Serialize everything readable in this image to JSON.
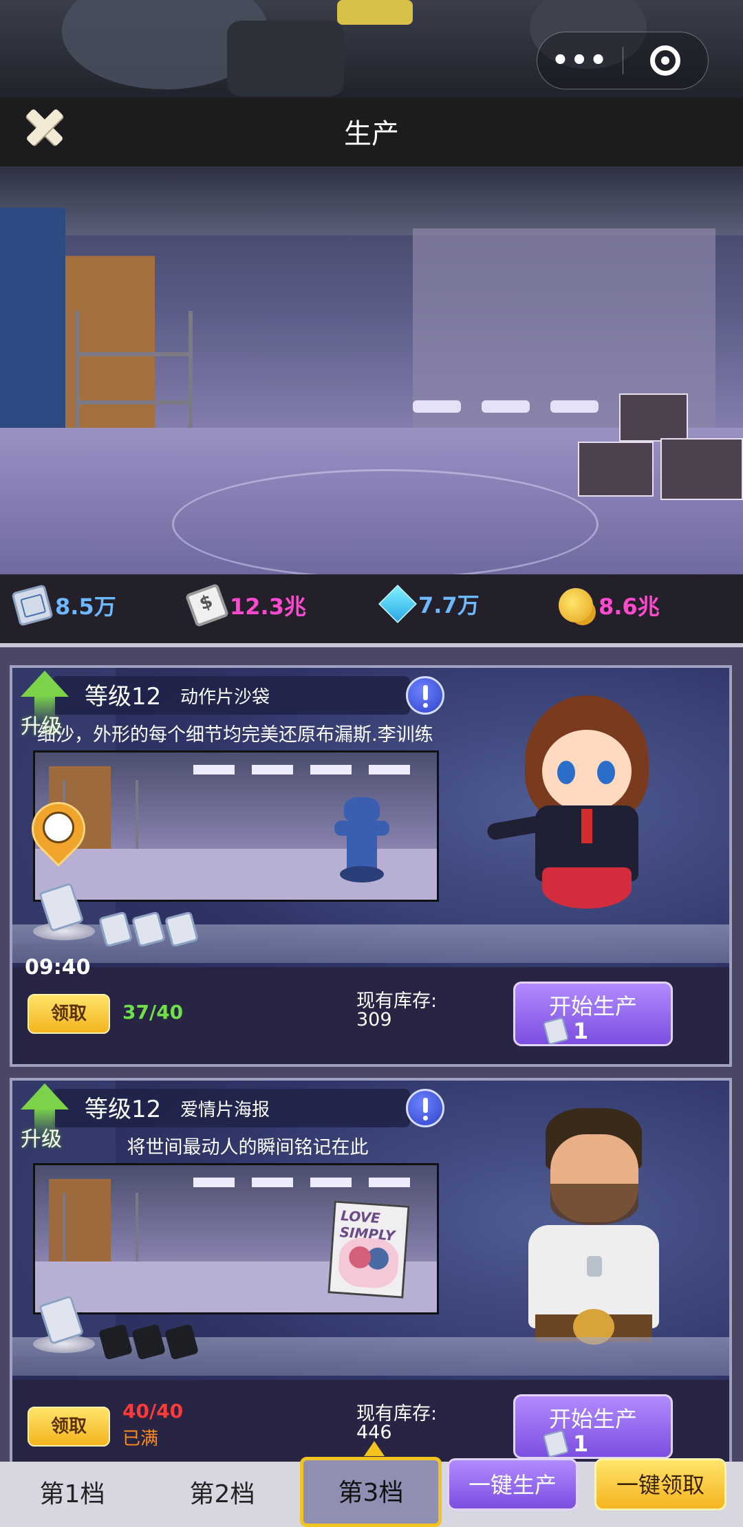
{
  "capsule": {
    "more_icon": "more-dots-icon",
    "close_icon": "target-circle-icon",
    "dots": "•••"
  },
  "header": {
    "title": "生产",
    "close_icon": "close-x-icon"
  },
  "resources": [
    {
      "icon": "blueprint-icon",
      "value": "8.5万",
      "color": "#6db8ff"
    },
    {
      "icon": "cash-icon",
      "value": "12.3兆",
      "color": "#ff4ad0"
    },
    {
      "icon": "diamond-icon",
      "value": "7.7万",
      "color": "#6db8ff"
    },
    {
      "icon": "gold-coins-icon",
      "value": "8.6兆",
      "color": "#ff4ad0"
    }
  ],
  "cards": [
    {
      "upgrade_label": "升级",
      "level": "等级12",
      "name": "动作片沙袋",
      "description": "细沙，外形的每个细节均完美还原布漏斯.李训练",
      "timer": "09:40",
      "claim_label": "领取",
      "capacity": "37/40",
      "capacity_status": "",
      "stock_label": "现有库存:",
      "stock_value": "309",
      "start_label": "开始生产",
      "start_cost": "1",
      "slots_filled": 3,
      "slots_total": 3
    },
    {
      "upgrade_label": "升级",
      "level": "等级12",
      "name": "爱情片海报",
      "description": "将世间最动人的瞬间铭记在此",
      "poster_title": "LOVE SIMPLY",
      "timer": "",
      "claim_label": "领取",
      "capacity": "40/40",
      "capacity_status": "已满",
      "stock_label": "现有库存:",
      "stock_value": "446",
      "start_label": "开始生产",
      "start_cost": "1",
      "slots_filled": 0,
      "slots_total": 3
    }
  ],
  "tabs": [
    {
      "label": "第1档",
      "active": false
    },
    {
      "label": "第2档",
      "active": false
    },
    {
      "label": "第3档",
      "active": true
    }
  ],
  "actions": {
    "produce_all": "一键生产",
    "claim_all": "一键领取"
  }
}
